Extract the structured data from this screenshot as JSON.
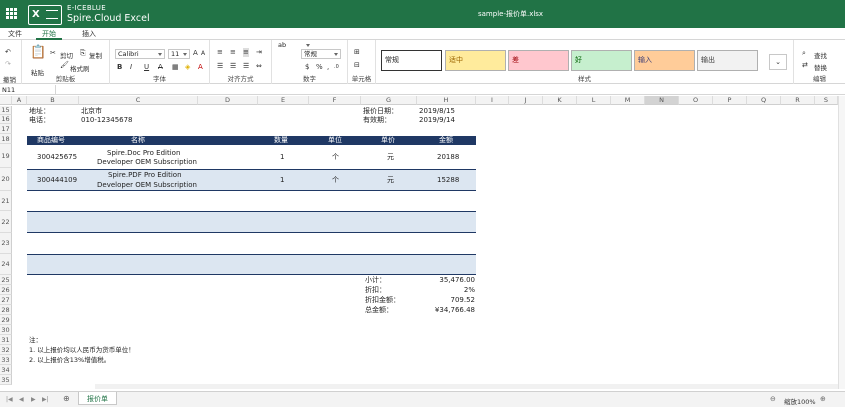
{
  "app": {
    "brand_top": "E-ICEBLUE",
    "brand_name": "Spire.Cloud Excel",
    "filename": "sample-报价单.xlsx",
    "logo_letter": "X",
    "accent": "#217346"
  },
  "tabs": [
    {
      "label": "文件"
    },
    {
      "label": "开始"
    },
    {
      "label": "插入"
    }
  ],
  "ribbon": {
    "undo": "撤销",
    "paste": "粘贴",
    "cut": "剪切",
    "copy": "复制",
    "format_painter": "格式刷",
    "clipboard_label": "剪贴板",
    "font_name": "Calibri",
    "font_size": "11",
    "bold": "B",
    "italic": "I",
    "underline": "U",
    "strike": "A",
    "font_label": "字体",
    "align_label": "对齐方式",
    "wrap": "ab",
    "number_format": "常规",
    "currency": "$",
    "percent": "%",
    "thousands": ",",
    "number_label": "数字",
    "cells_label": "单元格",
    "styles_label": "样式",
    "styles": [
      {
        "label": "常规",
        "bg": "#ffffff",
        "color": "#000000"
      },
      {
        "label": "适中",
        "bg": "#ffeb9c",
        "color": "#9c6500"
      },
      {
        "label": "差",
        "bg": "#ffc7ce",
        "color": "#9c0006"
      },
      {
        "label": "好",
        "bg": "#c6efce",
        "color": "#006100"
      },
      {
        "label": "输入",
        "bg": "#ffcc99",
        "color": "#3f3f76"
      },
      {
        "label": "输出",
        "bg": "#f2f2f2",
        "color": "#3f3f3f"
      }
    ],
    "find": "查找",
    "replace": "替换",
    "edit_label": "编辑"
  },
  "formula_bar": {
    "cell_ref": "N11"
  },
  "columns": [
    "A",
    "B",
    "C",
    "D",
    "E",
    "F",
    "G",
    "H",
    "I",
    "J",
    "K",
    "L",
    "M",
    "N",
    "O",
    "P",
    "Q",
    "R",
    "S"
  ],
  "selected_column": "N",
  "rows": [
    "15",
    "16",
    "17",
    "18",
    "19",
    "20",
    "21",
    "22",
    "23",
    "24",
    "25",
    "26",
    "27",
    "28",
    "29",
    "30",
    "31",
    "32",
    "33",
    "34",
    "35"
  ],
  "sheet": {
    "address_label": "地址：",
    "address_value": "北京市",
    "phone_label": "电话：",
    "phone_value": "010-12345678",
    "quote_date_label": "报价日期：",
    "quote_date_value": "2019/8/15",
    "valid_label": "有效期：",
    "valid_value": "2019/9/14",
    "table_headers": [
      "商品编号",
      "名称",
      "数量",
      "单位",
      "单价",
      "金额"
    ],
    "items": [
      {
        "code": "300425675",
        "name1": "Spire.Doc  Pro Edition",
        "name2": "Developer OEM Subscription",
        "qty": "1",
        "unit": "个",
        "price": "元",
        "amount": "20188"
      },
      {
        "code": "300444109",
        "name1": "Spire.PDF Pro Edition",
        "name2": "Developer OEM Subscription",
        "qty": "1",
        "unit": "个",
        "price": "元",
        "amount": "15288"
      }
    ],
    "subtotal_label": "小计：",
    "subtotal_value": "35,476.00",
    "discount_label": "折扣：",
    "discount_value": "2%",
    "discount_amount_label": "折扣金额：",
    "discount_amount_value": "709.52",
    "total_label": "总金额：",
    "total_value": "¥34,766.48",
    "note_title": "注：",
    "note1": "1. 以上报价均以人民币为货币单位！",
    "note2": "2. 以上报价含13%增值税。"
  },
  "status": {
    "sheet_tab": "报价单",
    "zoom": "缩放100%",
    "header_color": "#1f3864",
    "band_color": "#dce6f1"
  }
}
